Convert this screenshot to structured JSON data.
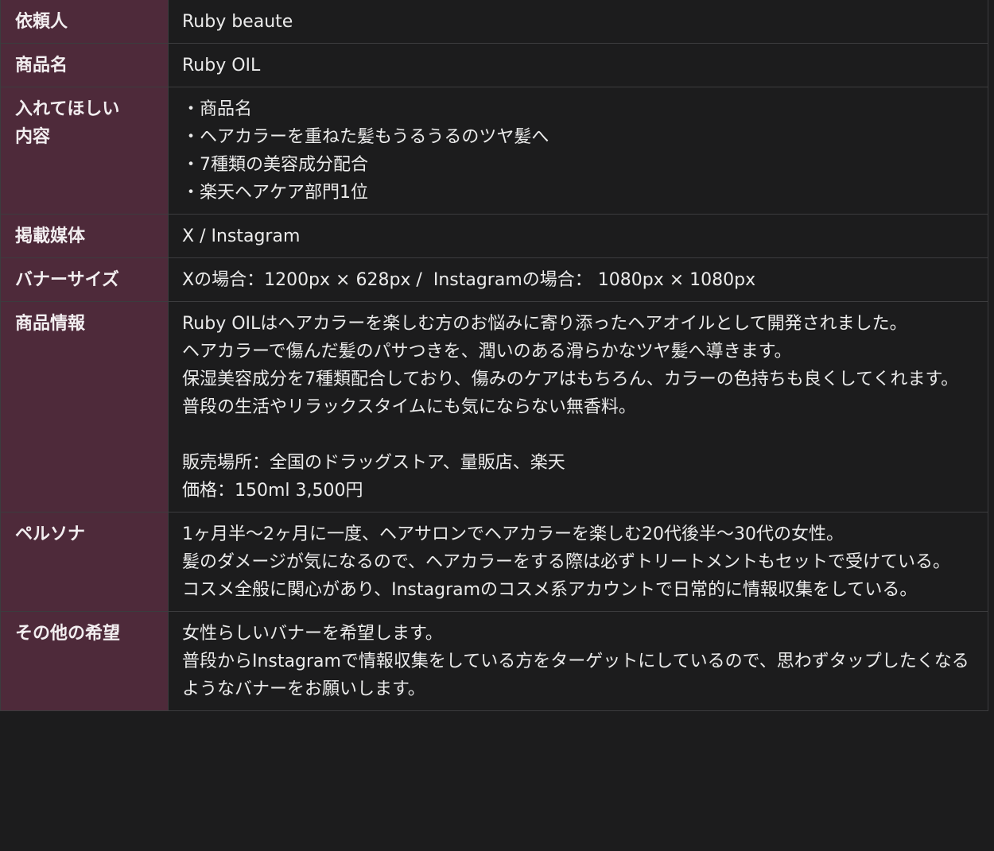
{
  "rows": [
    {
      "label": "依頼人",
      "value": "Ruby beaute"
    },
    {
      "label": "商品名",
      "value": "Ruby OIL"
    },
    {
      "label": "入れてほしい\n内容",
      "value": "・商品名\n・ヘアカラーを重ねた髪もうるうるのツヤ髪へ\n・7種類の美容成分配合\n・楽天ヘアケア部門1位"
    },
    {
      "label": "掲載媒体",
      "value": "X / Instagram"
    },
    {
      "label": "バナーサイズ",
      "value": "Xの場合：1200px × 628px /  Instagramの場合： 1080px × 1080px"
    },
    {
      "label": "商品情報",
      "value": "Ruby OILはヘアカラーを楽しむ方のお悩みに寄り添ったヘアオイルとして開発されました。\nヘアカラーで傷んだ髪のパサつきを、潤いのある滑らかなツヤ髪へ導きます。\n保湿美容成分を7種類配合しており、傷みのケアはもちろん、カラーの色持ちも良くしてくれます。\n普段の生活やリラックスタイムにも気にならない無香料。\n\n販売場所：全国のドラッグストア、量販店、楽天\n価格：150ml 3,500円"
    },
    {
      "label": "ペルソナ",
      "value": "1ヶ月半〜2ヶ月に一度、ヘアサロンでヘアカラーを楽しむ20代後半〜30代の女性。\n髪のダメージが気になるので、ヘアカラーをする際は必ずトリートメントもセットで受けている。\nコスメ全般に関心があり、Instagramのコスメ系アカウントで日常的に情報収集をしている。"
    },
    {
      "label": "その他の希望",
      "value": "女性らしいバナーを希望します。\n普段からInstagramで情報収集をしている方をターゲットにしているので、思わずタップしたくなるようなバナーをお願いします。"
    }
  ]
}
